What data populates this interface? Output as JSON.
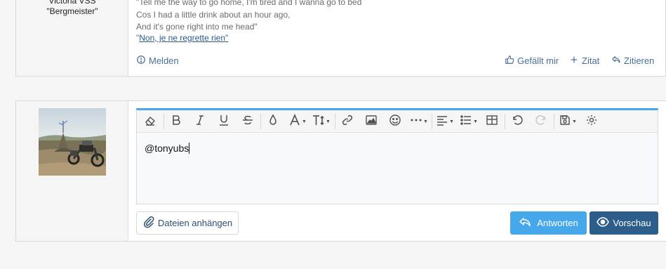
{
  "post": {
    "user_title_1": "Victoria VSS",
    "user_title_2": "\"Bergmeister\"",
    "quote_lines": [
      "\"Tell me the way to go home, I'm tired and I wanna go to bed",
      "Cos I had a little drink about an hour ago,",
      "And it's gone right into me head\""
    ],
    "quote_link_prefix": "\"",
    "quote_link": "Non, je ne regrette rien\"",
    "actions": {
      "report": "Melden",
      "like": "Gefällt mir",
      "quote": "Zitat",
      "reply": "Zitieren"
    }
  },
  "reply": {
    "editor_content": "@tonyubs",
    "toolbar_icons": [
      "eraser-icon",
      "bold-icon",
      "italic-icon",
      "underline-icon",
      "strikethrough-icon",
      "text-color-icon",
      "font-family-icon",
      "font-size-icon",
      "link-icon",
      "image-icon",
      "emoji-icon",
      "more-icon",
      "align-icon",
      "list-icon",
      "table-icon",
      "undo-icon",
      "redo-icon",
      "drafts-icon",
      "settings-icon"
    ],
    "attach_label": "Dateien anhängen",
    "submit_label": "Antworten",
    "preview_label": "Vorschau"
  },
  "colors": {
    "accent": "#47a7eb",
    "primary": "#2d5e8b",
    "link": "#4a6f96"
  }
}
